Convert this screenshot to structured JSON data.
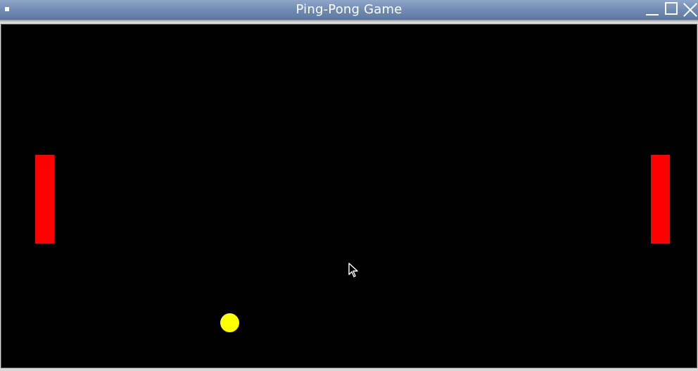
{
  "window": {
    "title": "Ping-Pong Game"
  },
  "colors": {
    "paddle": "#ff0000",
    "ball": "#ffff00",
    "background": "#000000",
    "titlebar": "#6f8ab2"
  },
  "icons": {
    "menu": "window-menu-icon",
    "minimize": "minimize-icon",
    "maximize": "maximize-icon",
    "close": "close-icon",
    "cursor": "mouse-pointer-icon"
  }
}
